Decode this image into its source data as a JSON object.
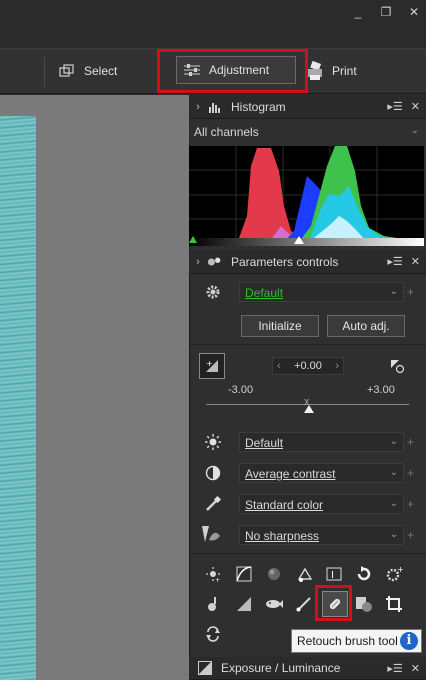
{
  "window": {
    "minimize_glyph": "_",
    "restore_glyph": "❐",
    "close_glyph": "✕"
  },
  "toolbar": {
    "select_label": "Select",
    "adjustment_label": "Adjustment",
    "print_label": "Print"
  },
  "histogram": {
    "title": "Histogram",
    "channel": "All channels"
  },
  "parameters": {
    "title": "Parameters controls",
    "preset": "Default",
    "initialize_label": "Initialize",
    "auto_adj_label": "Auto adj.",
    "exposure_value": "+0.00",
    "slider_min": "-3.00",
    "slider_max": "+3.00",
    "exposure_level": 0.0,
    "picture_control": "Default",
    "contrast": "Average contrast",
    "color": "Standard color",
    "sharpness": "No sharpness"
  },
  "tooltip": {
    "text": "Retouch brush tool",
    "info_glyph": "i"
  },
  "exposure_panel": {
    "title": "Exposure / Luminance"
  },
  "colors": {
    "highlight": "#d80c1a",
    "preset_green": "#2bbf2b",
    "info_blue": "#1f66c8"
  }
}
